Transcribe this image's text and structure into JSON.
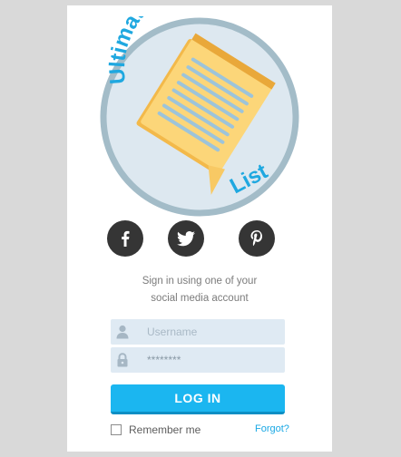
{
  "logo": {
    "word1": "Ultimate",
    "word2": "List",
    "icon": "notepad-icon"
  },
  "social": {
    "facebook": "facebook-icon",
    "twitter": "twitter-icon",
    "pinterest": "pinterest-icon"
  },
  "signin": {
    "line1": "Sign in using one of your",
    "line2": "social media account"
  },
  "form": {
    "username_placeholder": "Username",
    "password_value": "********",
    "login_label": "LOG IN",
    "remember_label": "Remember me",
    "forgot_label": "Forgot?"
  },
  "colors": {
    "accent": "#1bb6f0",
    "logo_text": "#1fa8e0",
    "field_bg": "#dfeaf3",
    "social_bg": "#353535"
  }
}
